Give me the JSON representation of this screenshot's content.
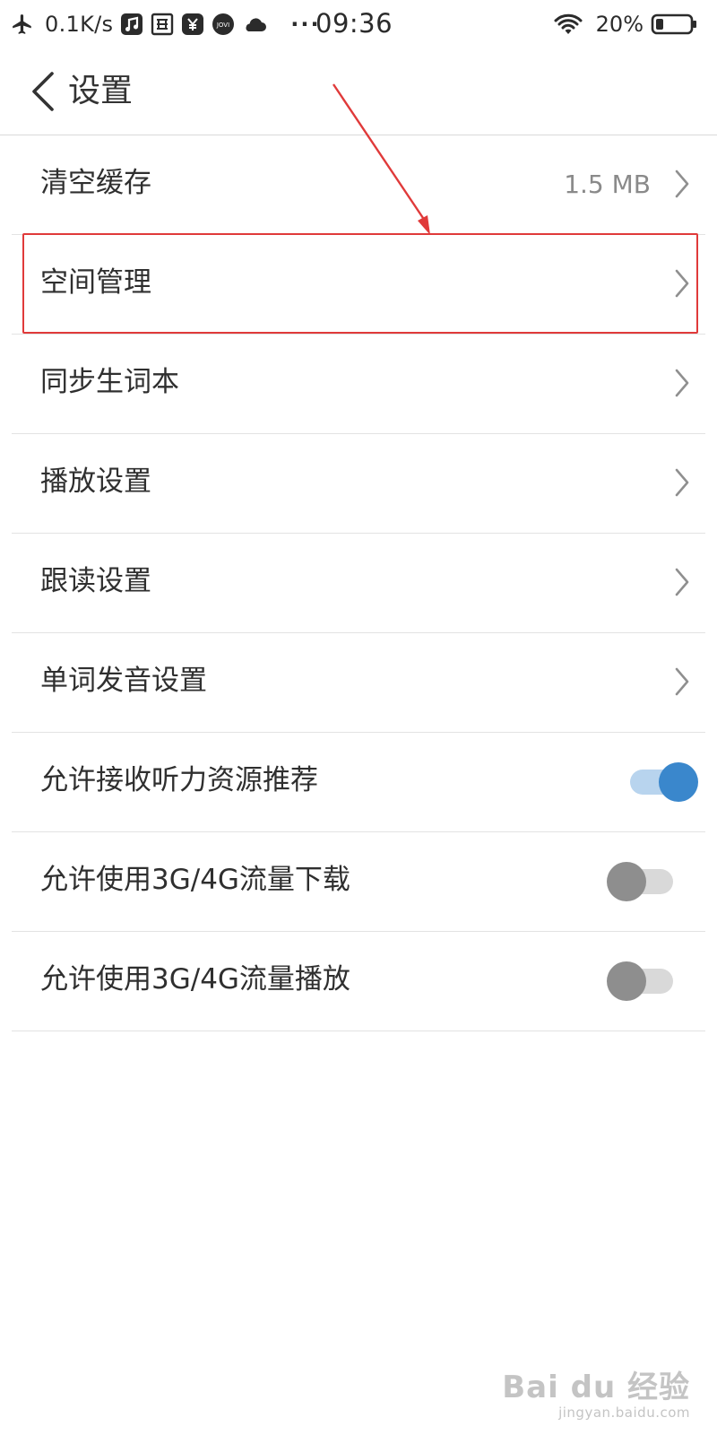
{
  "status_bar": {
    "network_speed": "0.1K/s",
    "time": "09:36",
    "battery_percent": "20%",
    "more_indicator": "···",
    "jovi_label": "JOVI",
    "icons": [
      "airplane-icon",
      "music-icon",
      "news-icon",
      "wallet-icon",
      "jovi-icon",
      "weather-icon",
      "wifi-icon",
      "battery-icon"
    ]
  },
  "header": {
    "title": "设置"
  },
  "settings": {
    "clear_cache": {
      "label": "清空缓存",
      "value": "1.5 MB"
    },
    "space_management": {
      "label": "空间管理"
    },
    "sync_vocabulary": {
      "label": "同步生词本"
    },
    "playback_settings": {
      "label": "播放设置"
    },
    "follow_reading": {
      "label": "跟读设置"
    },
    "word_pronunciation": {
      "label": "单词发音设置"
    },
    "listening_recommendations": {
      "label": "允许接收听力资源推荐",
      "enabled": true
    },
    "mobile_data_download": {
      "label": "允许使用3G/4G流量下载",
      "enabled": false
    },
    "mobile_data_playback": {
      "label": "允许使用3G/4G流量播放",
      "enabled": false
    }
  },
  "annotation": {
    "color": "#e03a3a",
    "target": "space_management"
  },
  "colors": {
    "toggle_on": "#3a87cc",
    "toggle_on_track": "#b8d4ee",
    "toggle_off": "#8e8e8e",
    "toggle_off_track": "#d9d9d9"
  },
  "watermark": {
    "main": "Bai du 经验",
    "sub": "jingyan.baidu.com"
  }
}
